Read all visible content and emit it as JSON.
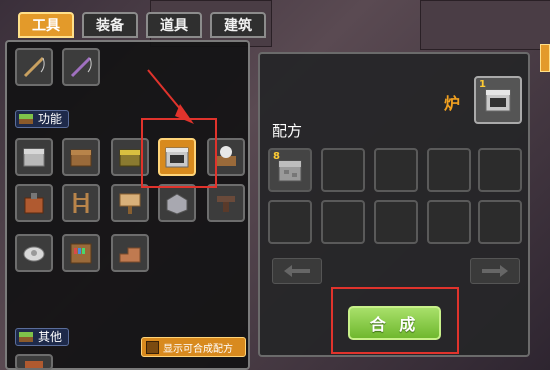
{
  "tabs": [
    {
      "label": "工具",
      "active": true
    },
    {
      "label": "装备",
      "active": false
    },
    {
      "label": "道具",
      "active": false
    },
    {
      "label": "建筑",
      "active": false
    }
  ],
  "sections": {
    "function_label": "功能",
    "other_label": "其他"
  },
  "filter": {
    "label": "显示可合成配方"
  },
  "recipe": {
    "title": "配方",
    "output_name": "炉",
    "output_count": "1",
    "ingredient_count": "8"
  },
  "craft_button": {
    "label": "合 成"
  },
  "colors": {
    "active_tab": "#e39a2a",
    "selected_slot": "#d88a1e",
    "highlight_red": "#e0332c",
    "craft_green": "#7cc43a",
    "accent_orange": "#f0a020"
  }
}
